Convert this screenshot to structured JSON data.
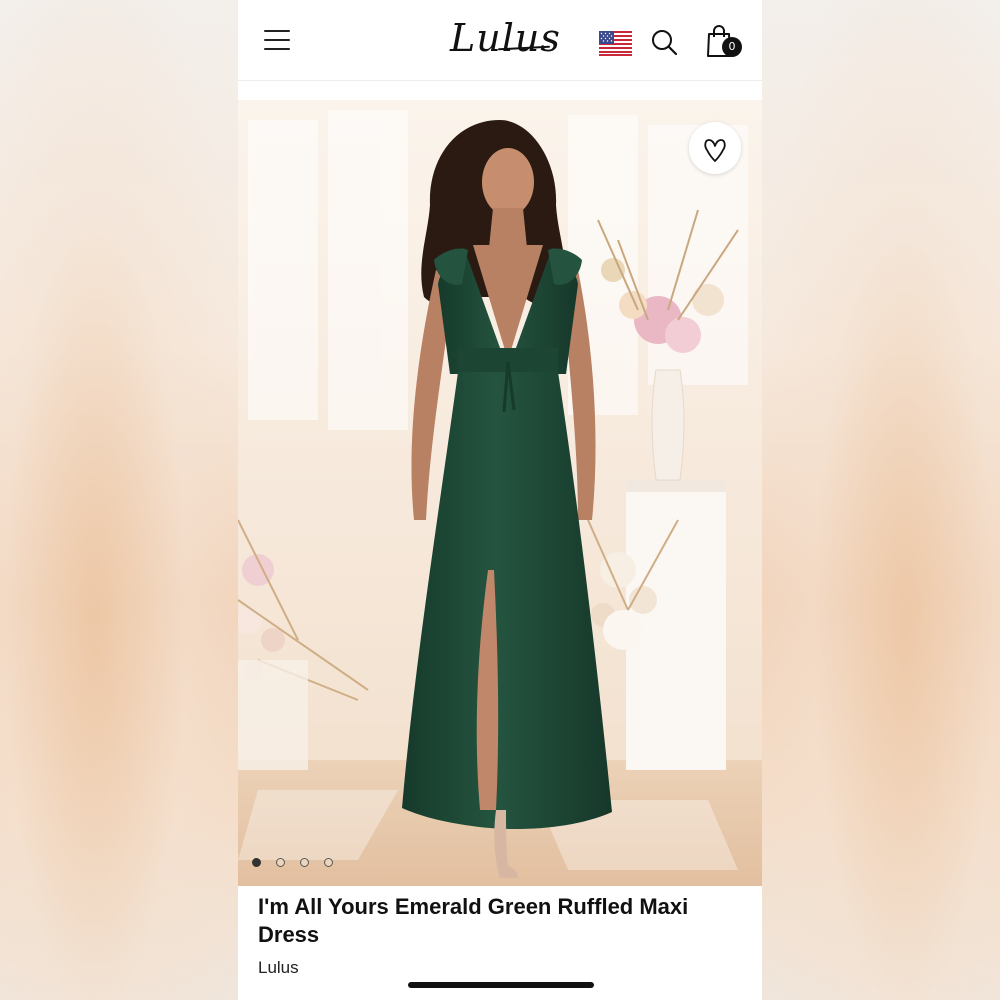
{
  "header": {
    "logo_text": "Lulus",
    "cart_count": "0",
    "menu_icon": "hamburger-menu-icon",
    "flag_icon": "us-flag-icon",
    "search_icon": "search-icon",
    "cart_icon": "shopping-bag-icon"
  },
  "gallery": {
    "image_count": 4,
    "active_index": 0,
    "wishlist_icon": "heart-icon"
  },
  "product": {
    "title": "I'm All Yours Emerald Green Ruffled Maxi Dress",
    "brand": "Lulus"
  },
  "colors": {
    "dress": "#1f4a38",
    "accent": "#111111",
    "background": "#ffffff"
  }
}
